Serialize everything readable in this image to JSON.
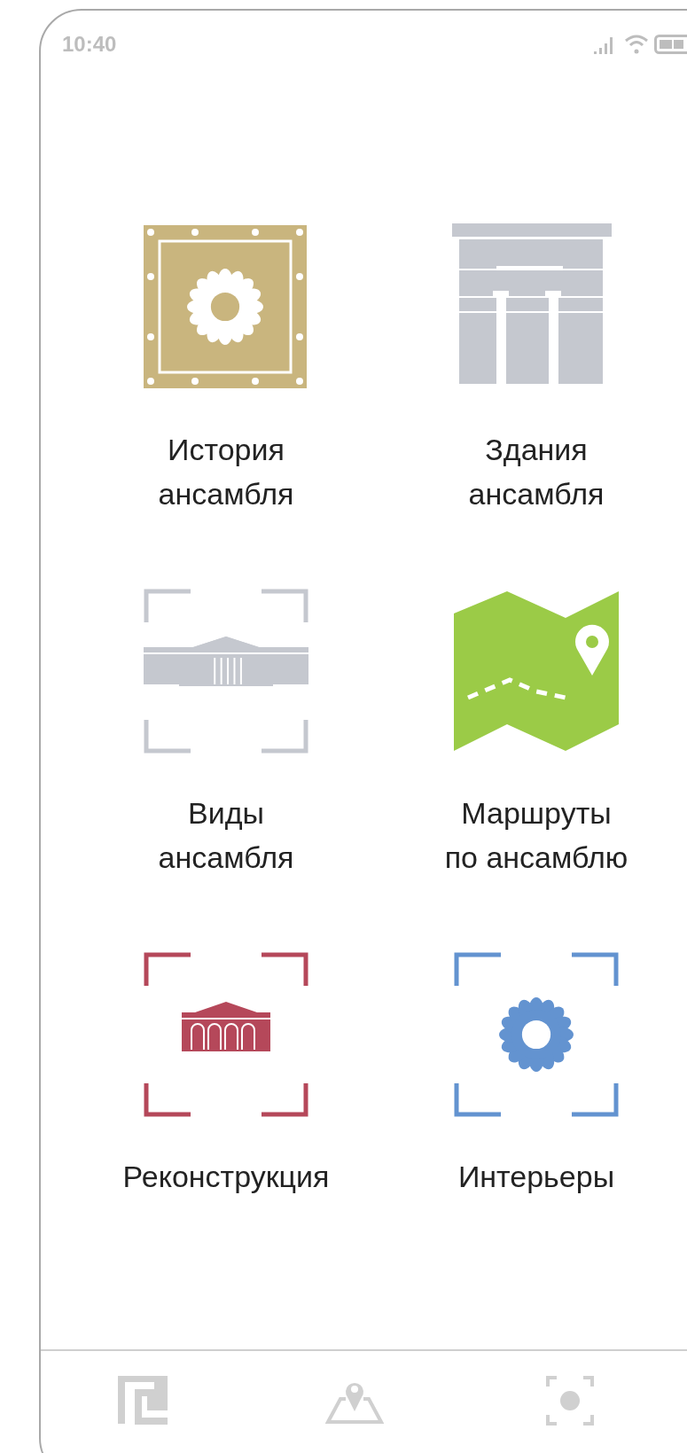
{
  "status_bar": {
    "time": "10:40"
  },
  "tiles": [
    {
      "kind": "history",
      "label": "История\nансамбля"
    },
    {
      "kind": "buildings",
      "label": "Здания\nансамбля"
    },
    {
      "kind": "views",
      "label": "Виды\nансамбля"
    },
    {
      "kind": "routes",
      "label": "Маршруты\nпо ансамблю"
    },
    {
      "kind": "reconstruction",
      "label": "Реконструкция"
    },
    {
      "kind": "interiors",
      "label": "Интерьеры"
    }
  ],
  "nav": [
    {
      "kind": "meander"
    },
    {
      "kind": "map"
    },
    {
      "kind": "focus"
    }
  ]
}
